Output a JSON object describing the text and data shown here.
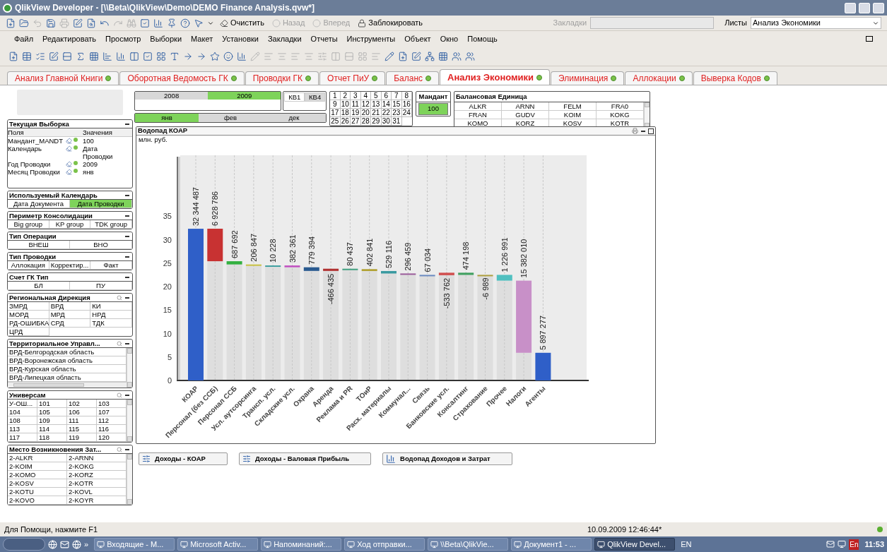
{
  "window": {
    "title": "QlikView Developer - [\\\\Beta\\QlikView\\Demo\\DEMO Finance Analysis.qvw*]"
  },
  "toolbar": {
    "buttons": [
      {
        "label": "Очистить",
        "disabled": false
      },
      {
        "label": "Назад",
        "disabled": true
      },
      {
        "label": "Вперед",
        "disabled": true
      },
      {
        "label": "Заблокировать",
        "disabled": false
      }
    ],
    "bookmarks": {
      "label": "Закладки",
      "disabled": true
    },
    "sheets": {
      "label": "Листы",
      "value": "Анализ Экономики"
    }
  },
  "menu": [
    "Файл",
    "Редактировать",
    "Просмотр",
    "Выборки",
    "Макет",
    "Установки",
    "Закладки",
    "Отчеты",
    "Инструменты",
    "Объект",
    "Окно",
    "Помощь"
  ],
  "tabs": [
    {
      "label": "Анализ Главной Книги",
      "selected": false
    },
    {
      "label": "Оборотная Ведомость ГК",
      "selected": false
    },
    {
      "label": "Проводки ГК",
      "selected": false
    },
    {
      "label": "Отчет ПиУ",
      "selected": false
    },
    {
      "label": "Баланс",
      "selected": false
    },
    {
      "label": "Анализ Экономики",
      "selected": true
    },
    {
      "label": "Элиминация",
      "selected": false
    },
    {
      "label": "Аллокации",
      "selected": false
    },
    {
      "label": "Выверка Кодов",
      "selected": false
    }
  ],
  "selectors": {
    "years": [
      {
        "label": "2008",
        "selected": false,
        "excluded": true
      },
      {
        "label": "2009",
        "selected": true,
        "excluded": false
      }
    ],
    "quarters": [
      {
        "label": "КВ1",
        "selected": false,
        "excluded": false
      },
      {
        "label": "КВ4",
        "selected": false,
        "excluded": true
      }
    ],
    "months": [
      {
        "label": "янв",
        "selected": true,
        "excluded": false
      },
      {
        "label": "фев",
        "selected": false,
        "excluded": true
      },
      {
        "label": "дек",
        "selected": false,
        "excluded": true
      }
    ],
    "days": [
      "1",
      "2",
      "3",
      "4",
      "5",
      "6",
      "7",
      "8",
      "9",
      "10",
      "11",
      "12",
      "13",
      "14",
      "15",
      "16",
      "17",
      "18",
      "19",
      "20",
      "21",
      "22",
      "23",
      "24",
      "25",
      "26",
      "27",
      "28",
      "29",
      "30",
      "31"
    ],
    "mandant": {
      "title": "Мандант",
      "value": "100",
      "selected": true
    },
    "balance_unit": {
      "title": "Балансовая Единица",
      "items": [
        "ALKR",
        "ARNN",
        "FELM",
        "FRA0",
        "FRAN",
        "GUDV",
        "KOIM",
        "KOKG",
        "KOMO",
        "KORZ",
        "KOSV",
        "KOTR"
      ]
    }
  },
  "current_selections": {
    "title": "Текущая Выборка",
    "headers": [
      "Поля",
      "Значения"
    ],
    "rows": [
      {
        "field": "Мандант_MANDT",
        "value": "100"
      },
      {
        "field": "Календарь",
        "value": "Дата Проводки"
      },
      {
        "field": "Год Проводки",
        "value": "2009"
      },
      {
        "field": "Месяц Проводки",
        "value": "янв"
      }
    ]
  },
  "list_boxes": [
    {
      "title": "Используемый Календарь",
      "kind": "plain",
      "searchable": false,
      "rows": [
        [
          {
            "label": "Дата Документа",
            "selected": false
          },
          {
            "label": "Дата Проводки",
            "selected": true
          }
        ]
      ]
    },
    {
      "title": "Периметр Консолидации",
      "kind": "plain",
      "searchable": false,
      "rows": [
        [
          {
            "label": "Big group",
            "selected": false
          },
          {
            "label": "KP group",
            "selected": false
          },
          {
            "label": "TDK group",
            "selected": false
          }
        ]
      ]
    },
    {
      "title": "Тип Операции",
      "kind": "plain",
      "searchable": false,
      "rows": [
        [
          {
            "label": "ВНЕШ",
            "selected": false
          },
          {
            "label": "ВНО",
            "selected": false
          }
        ]
      ]
    },
    {
      "title": "Тип Проводки",
      "kind": "plain",
      "searchable": false,
      "rows": [
        [
          {
            "label": "Аллокация",
            "selected": false
          },
          {
            "label": "Корректир...",
            "selected": false
          },
          {
            "label": "Факт",
            "selected": false
          }
        ]
      ]
    },
    {
      "title": "Счет ГК Тип",
      "kind": "plain",
      "searchable": false,
      "rows": [
        [
          {
            "label": "БЛ",
            "selected": false
          },
          {
            "label": "ПУ",
            "selected": false
          }
        ]
      ]
    },
    {
      "title": "Региональная Дирекция",
      "kind": "grid",
      "searchable": true,
      "rows": [
        [
          {
            "label": "ЗМРД",
            "selected": false
          },
          {
            "label": "ВРД",
            "selected": false
          },
          {
            "label": "КИ",
            "selected": false
          }
        ],
        [
          {
            "label": "МОРД",
            "selected": false
          },
          {
            "label": "МРД",
            "selected": false
          },
          {
            "label": "НРД",
            "selected": false
          }
        ],
        [
          {
            "label": "РД-ОШИБКА",
            "selected": false
          },
          {
            "label": "СРД",
            "selected": false
          },
          {
            "label": "ТДК",
            "selected": false
          }
        ],
        [
          {
            "label": "ЦРД",
            "selected": false
          }
        ]
      ]
    },
    {
      "title": "Территориальное Управл...",
      "kind": "scroll_both",
      "searchable": true,
      "rows": [
        [
          {
            "label": "ВРД-Белгородская область",
            "selected": false
          }
        ],
        [
          {
            "label": "ВРД-Воронежская область",
            "selected": false
          }
        ],
        [
          {
            "label": "ВРД-Курская область",
            "selected": false
          }
        ],
        [
          {
            "label": "ВРД-Липецкая область",
            "selected": false
          }
        ]
      ]
    },
    {
      "title": "Универсам",
      "kind": "scroll",
      "searchable": true,
      "rows": [
        [
          {
            "label": "У-ОШ...",
            "selected": false
          },
          {
            "label": "101",
            "selected": false
          },
          {
            "label": "102",
            "selected": false
          },
          {
            "label": "103",
            "selected": false
          }
        ],
        [
          {
            "label": "104",
            "selected": false
          },
          {
            "label": "105",
            "selected": false
          },
          {
            "label": "106",
            "selected": false
          },
          {
            "label": "107",
            "selected": false
          }
        ],
        [
          {
            "label": "108",
            "selected": false
          },
          {
            "label": "109",
            "selected": false
          },
          {
            "label": "111",
            "selected": false
          },
          {
            "label": "112",
            "selected": false
          }
        ],
        [
          {
            "label": "113",
            "selected": false
          },
          {
            "label": "114",
            "selected": false
          },
          {
            "label": "115",
            "selected": false
          },
          {
            "label": "116",
            "selected": false
          }
        ],
        [
          {
            "label": "117",
            "selected": false
          },
          {
            "label": "118",
            "selected": false
          },
          {
            "label": "119",
            "selected": false
          },
          {
            "label": "120",
            "selected": false
          }
        ]
      ]
    },
    {
      "title": "Место Возникновения Зат...",
      "kind": "scroll",
      "searchable": true,
      "rows": [
        [
          {
            "label": "2-ALKR",
            "selected": false
          },
          {
            "label": "2-ARNN",
            "selected": false
          }
        ],
        [
          {
            "label": "2-KOIM",
            "selected": false
          },
          {
            "label": "2-KOKG",
            "selected": false
          }
        ],
        [
          {
            "label": "2-KOMO",
            "selected": false
          },
          {
            "label": "2-KORZ",
            "selected": false
          }
        ],
        [
          {
            "label": "2-KOSV",
            "selected": false
          },
          {
            "label": "2-KOTR",
            "selected": false
          }
        ],
        [
          {
            "label": "2-KOTU",
            "selected": false
          },
          {
            "label": "2-KOVL",
            "selected": false
          }
        ],
        [
          {
            "label": "2-KOVO",
            "selected": false
          },
          {
            "label": "2-KOYR",
            "selected": false
          }
        ]
      ]
    }
  ],
  "chart": {
    "title": "Водопад КОАР",
    "unit": "млн. руб.",
    "chart_data": {
      "type": "bar",
      "stacked": true,
      "grid": true,
      "categories": [
        "КОАР",
        "Персонал (без ССБ)",
        "Персонал ССБ",
        "Усл. аутсорсинга",
        "Трансп. усл.",
        "Складские усл.",
        "Охрана",
        "Аренда",
        "Реклама и PR",
        "ТОиР",
        "Расх. материалы",
        "Коммунал...",
        "Связь",
        "Банковские усл.",
        "Консалтинг",
        "Страхование",
        "Прочее",
        "Налоги",
        "Агенты"
      ],
      "series": [
        {
          "color": "#dedede",
          "values": [
            0,
            25.42,
            24.73,
            24.52,
            24.51,
            24.13,
            23.35,
            23.35,
            23.74,
            23.33,
            22.8,
            22.51,
            22.44,
            22.44,
            22.5,
            22.5,
            21.28,
            5.9,
            0
          ]
        },
        {
          "values": [
            32.34,
            6.93,
            0.69,
            0.21,
            0.01,
            0.38,
            0.78,
            0.47,
            0.08,
            0.4,
            0.53,
            0.3,
            0.07,
            0.53,
            0.47,
            0.01,
            1.23,
            15.38,
            5.9
          ],
          "colors": [
            "#2f5fc8",
            "#c83232",
            "#33b040",
            "#c8c040",
            "#40a0a0",
            "#c050c0",
            "#2a5a90",
            "#b03030",
            "#40a080",
            "#b0a030",
            "#3a9aa0",
            "#9a5a9a",
            "#6a8ac0",
            "#d05050",
            "#40a060",
            "#b0a040",
            "#50c0c0",
            "#c890c8",
            "#2f5fc8"
          ]
        }
      ],
      "value_labels": [
        "32 344 487",
        "6 928 786",
        "687 692",
        "206 847",
        "10 228",
        "382 361",
        "779 394",
        "-466 435",
        "80 437",
        "402 841",
        "529 116",
        "296 459",
        "67 034",
        "-533 762",
        "474 198",
        "-6 989",
        "1 226 991",
        "15 382 010",
        "5 897 277"
      ],
      "ylim": [
        0,
        48
      ],
      "yticks": [
        0,
        5,
        10,
        15,
        20,
        25,
        30,
        35
      ]
    }
  },
  "sheet_buttons": [
    {
      "label": "Доходы - КОАР",
      "kind": "link"
    },
    {
      "label": "Доходы - Валовая Прибыль",
      "kind": "link"
    },
    {
      "label": "Водопад Доходов и Затрат",
      "kind": "chart"
    }
  ],
  "status_bar": {
    "help": "Для Помощи, нажмите F1",
    "timestamp": "10.09.2009 12:46:44*"
  },
  "taskbar": {
    "more": "»",
    "items": [
      {
        "label": "Входящие - M...",
        "selected": false
      },
      {
        "label": "Microsoft Activ...",
        "selected": false
      },
      {
        "label": "Напоминаний:...",
        "selected": false
      },
      {
        "label": "Ход отправки...",
        "selected": false
      },
      {
        "label": "\\\\Beta\\QlikVie...",
        "selected": false
      },
      {
        "label": "Документ1 - ...",
        "selected": false
      },
      {
        "label": "QlikView Devel...",
        "selected": true
      }
    ],
    "language": "EN",
    "tray_language": "En",
    "clock": "11:53"
  }
}
